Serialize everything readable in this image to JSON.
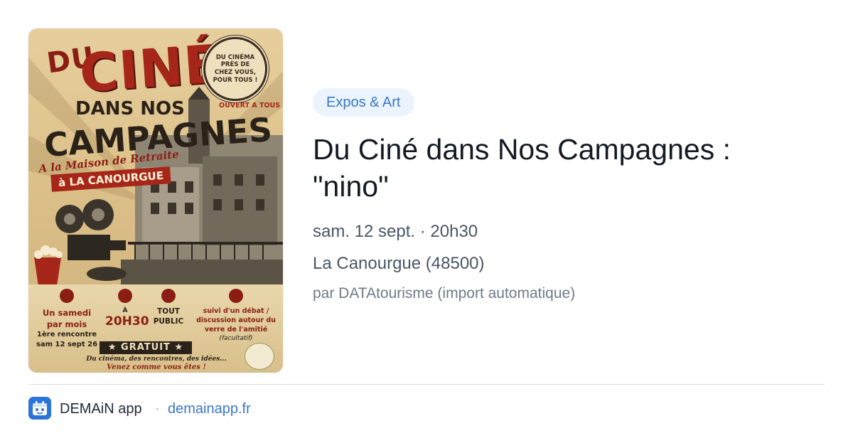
{
  "poster": {
    "du": "DU",
    "cine": "CINÉ",
    "dans_nos": "DANS NOS",
    "campagnes": "CAMPAGNES",
    "maison": "A la Maison de Retraite",
    "canourgue": "à LA CANOURGUE",
    "badge": "DU CINÉMA PRÈS DE CHEZ VOUS, POUR TOUS !",
    "ouvert": "OUVERT A TOUS",
    "col1_line1": "Un samedi",
    "col1_line2": "par mois",
    "col1_line3": "1ère rencontre",
    "col1_line4": "sam 12 sept 26",
    "col2_small": "À",
    "col2_big": "20H30",
    "col3_line1": "TOUT",
    "col3_line2": "PUBLIC",
    "col4_text": "suivi d'un débat / discussion autour du verre de l'amitié",
    "col4_note": "(facultatif)",
    "gratuit": "★ GRATUIT ★",
    "tagline1": "Du cinéma, des rencontres, des idées...",
    "tagline2": "Venez comme vous êtes !"
  },
  "category": "Expos & Art",
  "title": "Du Ciné dans Nos Campagnes : \"nino\"",
  "date": "sam. 12 sept. · 20h30",
  "location": "La Canourgue (48500)",
  "author": "par DATAtourisme (import automatique)",
  "footer": {
    "app_name": "DEMAiN app",
    "separator": "·",
    "url": "demainapp.fr"
  },
  "colors": {
    "accent": "#3a78c2",
    "tag_bg": "#ebf4fd",
    "poster_red": "#a6261a"
  }
}
